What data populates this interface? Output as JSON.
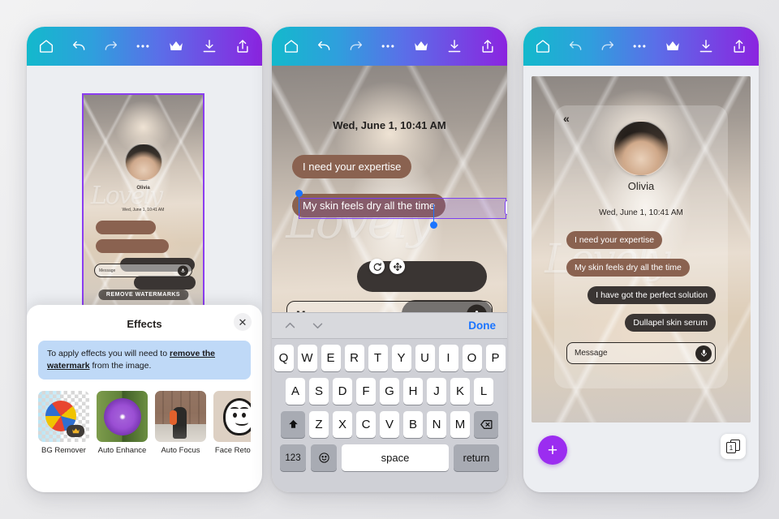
{
  "toolbar": {
    "home_icon": "home-icon",
    "undo_icon": "undo-icon",
    "redo_icon": "redo-icon",
    "more_icon": "more-options-icon",
    "crown_icon": "crown-premium-icon",
    "download_icon": "download-icon",
    "share_icon": "share-icon",
    "gradient_start": "#13b9cc",
    "gradient_end": "#8b24e0"
  },
  "left_phone": {
    "watermark_script": "Lovely",
    "remove_watermarks_label": "REMOVE WATERMARKS",
    "mini_chat": {
      "name": "Olivia",
      "date": "Wed, June 1, 10:41 AM",
      "message_placeholder": "Message"
    },
    "effects_sheet": {
      "title": "Effects",
      "close_label": "✕",
      "notice_prefix": "To apply effects you will need to ",
      "notice_link": "remove the watermark",
      "notice_suffix": " from the image.",
      "notice_bg": "#bfd9f7",
      "items": [
        {
          "label": "BG Remover",
          "thumb": "beach-ball-transparency-thumb",
          "premium": true
        },
        {
          "label": "Auto Enhance",
          "thumb": "purple-flower-split-thumb",
          "premium": false
        },
        {
          "label": "Auto Focus",
          "thumb": "street-person-thumb",
          "premium": false
        },
        {
          "label": "Face Retouch",
          "thumb": "face-doodle-thumb",
          "premium": false
        }
      ]
    }
  },
  "middle_phone": {
    "watermark_script": "Lovely",
    "chat_date": "Wed, June 1, 10:41 AM",
    "bubble_1": "I need your expertise",
    "bubble_2_editing": "My skin feels dry all the time",
    "bubble_brown_color": "#8a6250",
    "bubble_dark_color": "#3a3533",
    "selection_color": "#7b3ff2",
    "handle_color": "#1a74ff",
    "rotate_handle_icon": "rotate-icon",
    "move_handle_icon": "move-icon",
    "message_placeholder": "Message",
    "mic_icon": "microphone-icon",
    "keyboard": {
      "prev_icon": "chevron-up-icon",
      "next_icon": "chevron-down-icon",
      "done_label": "Done",
      "row1": [
        "Q",
        "W",
        "E",
        "R",
        "T",
        "Y",
        "U",
        "I",
        "O",
        "P"
      ],
      "row2": [
        "A",
        "S",
        "D",
        "F",
        "G",
        "H",
        "J",
        "K",
        "L"
      ],
      "row3": [
        "Z",
        "X",
        "C",
        "V",
        "B",
        "N",
        "M"
      ],
      "shift_icon": "shift-icon",
      "backspace_icon": "backspace-icon",
      "numbers_label": "123",
      "emoji_icon": "emoji-icon",
      "space_label": "space",
      "return_label": "return"
    }
  },
  "right_phone": {
    "watermark_script": "Lovely",
    "back_label": "«",
    "contact_name": "Olivia",
    "chat_date": "Wed, June 1, 10:41 AM",
    "messages": [
      {
        "text": "I need your expertise",
        "side": "left",
        "color": "#8a6250"
      },
      {
        "text": "My skin feels dry all the time",
        "side": "left",
        "color": "#8a6250"
      },
      {
        "text": "I have got the perfect solution",
        "side": "right",
        "color": "#3a3533"
      },
      {
        "text": "Dullapel skin serum",
        "side": "right",
        "color": "#3a3533"
      }
    ],
    "message_placeholder": "Message",
    "mic_icon": "microphone-icon",
    "add_label": "+",
    "add_color": "#9b2df0",
    "layers_count": "1"
  }
}
